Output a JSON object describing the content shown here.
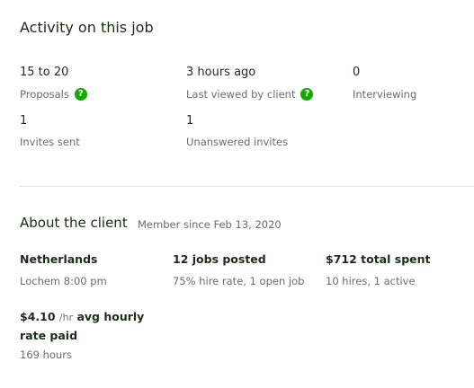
{
  "activity": {
    "title": "Activity on this job",
    "stats": [
      {
        "value": "15 to 20",
        "label": "Proposals"
      },
      {
        "value": "3 hours ago",
        "label": "Last viewed by client"
      },
      {
        "value": "0",
        "label": "Interviewing"
      },
      {
        "value": "1",
        "label": "Invites sent"
      },
      {
        "value": "1",
        "label": "Unanswered invites"
      }
    ],
    "help_glyph": "?"
  },
  "client": {
    "title": "About the client",
    "member_since": "Member since Feb 13, 2020",
    "location": {
      "value": "Netherlands",
      "sub": "Lochem 8:00 pm"
    },
    "jobs": {
      "value": "12 jobs posted",
      "sub": "75% hire rate, 1 open job"
    },
    "spent": {
      "value": "$712 total spent",
      "sub": "10 hires, 1 active"
    },
    "rate": {
      "amount": "$4.10",
      "unit": "/hr",
      "label": "avg hourly rate paid",
      "sub": "169 hours"
    }
  },
  "colors": {
    "accent": "#14a800",
    "muted": "#6b6b6b"
  }
}
